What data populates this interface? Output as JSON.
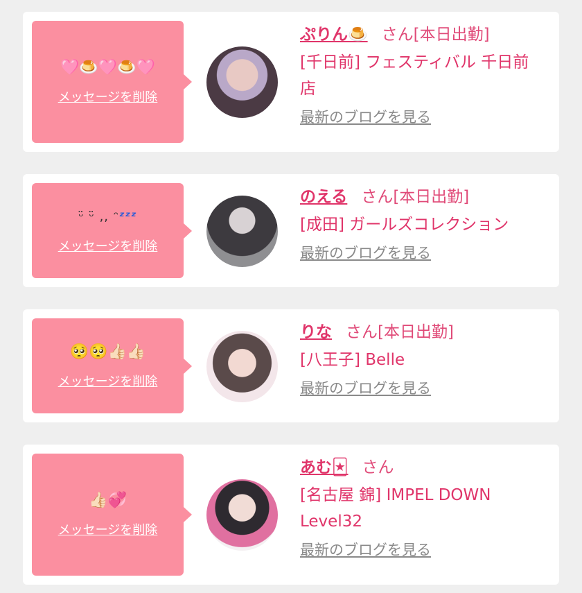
{
  "cards": [
    {
      "message": "🩷🍮🩷🍮🩷",
      "delete_label": "メッセージを削除",
      "name": "ぷりん🍮",
      "suffix": "さん[本日出勤]",
      "shop": "[千日前] フェスティバル 千日前店",
      "blog_label": "最新のブログを見る"
    },
    {
      "message_prefix": "ᵕ̈ ᵕ̈ ,, ᵔ",
      "message_zz": "ᶻᶻᶻ",
      "delete_label": "メッセージを削除",
      "name": "のえる",
      "suffix": "さん[本日出勤]",
      "shop": "[成田] ガールズコレクション",
      "blog_label": "最新のブログを見る"
    },
    {
      "message": "🥺🥺👍🏻👍🏻",
      "delete_label": "メッセージを削除",
      "name": "りな",
      "suffix": "さん[本日出勤]",
      "shop": "[八王子] Belle",
      "blog_label": "最新のブログを見る"
    },
    {
      "message": "👍🏻💞",
      "delete_label": "メッセージを削除",
      "name": "あむ🃏",
      "suffix": "さん",
      "shop": "[名古屋 錦] IMPEL DOWN Level32",
      "blog_label": "最新のブログを見る"
    }
  ],
  "colors": {
    "page_bg": "#efefef",
    "card_bg": "#ffffff",
    "bubble_bg": "#fb8fa0",
    "name_color": "#e0356a",
    "blog_link": "#8a8a8a"
  },
  "icons": [
    "avatar-photo"
  ]
}
